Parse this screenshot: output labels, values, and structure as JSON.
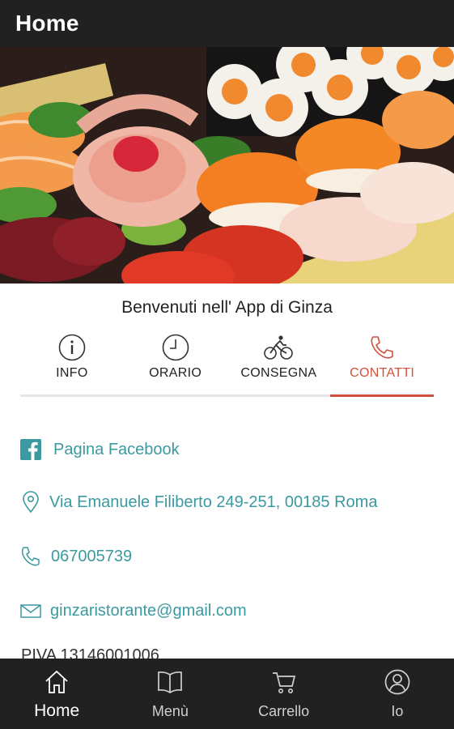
{
  "appbar": {
    "title": "Home"
  },
  "hero": {
    "slides": 3,
    "active_slide": 1
  },
  "welcome": "Benvenuti nell' App di Ginza",
  "tabs": [
    {
      "label": "INFO",
      "icon": "info-icon"
    },
    {
      "label": "ORARIO",
      "icon": "clock-icon"
    },
    {
      "label": "CONSEGNA",
      "icon": "bicycle-icon"
    },
    {
      "label": "CONTATTI",
      "icon": "phone-icon",
      "active": true
    }
  ],
  "contacts": {
    "facebook": "Pagina Facebook",
    "address": "Via Emanuele Filiberto 249-251, 00185 Roma",
    "phone": "067005739",
    "email": "ginzaristorante@gmail.com",
    "piva": "PIVA 13146001006"
  },
  "bottom_nav": [
    {
      "label": "Home",
      "icon": "home-icon",
      "active": true
    },
    {
      "label": "Menù",
      "icon": "book-icon"
    },
    {
      "label": "Carrello",
      "icon": "cart-icon"
    },
    {
      "label": "Io",
      "icon": "user-icon"
    }
  ],
  "colors": {
    "accent": "#d0513f",
    "link": "#3a9aa0",
    "bar": "#212121",
    "dot_active": "#1e88e5"
  }
}
